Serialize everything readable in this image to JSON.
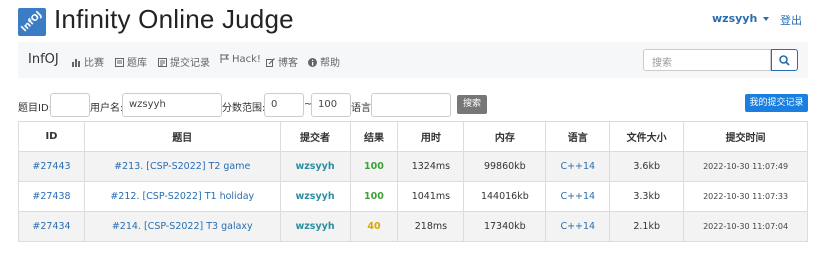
{
  "header": {
    "logo_text": "InfOJ",
    "title": "Infinity Online Judge",
    "user": "wzsyyh",
    "logout": "登出"
  },
  "navbar": {
    "brand": "InfOJ",
    "items": [
      {
        "label": "比赛",
        "icon": "bar-chart-icon"
      },
      {
        "label": "题库",
        "icon": "book-icon"
      },
      {
        "label": "提交记录",
        "icon": "list-icon"
      },
      {
        "label": "Hack!",
        "icon": "flag-icon"
      },
      {
        "label": "博客",
        "icon": "edit-icon"
      },
      {
        "label": "帮助",
        "icon": "info-icon"
      }
    ],
    "search_placeholder": "搜索"
  },
  "filters": {
    "problem_id_label": "题目ID:",
    "problem_id_value": "",
    "username_label": "用户名:",
    "username_value": "wzsyyh",
    "score_label": "分数范围:",
    "score_min": "0",
    "score_sep": "~",
    "score_max": "100",
    "lang_label": "语言:",
    "lang_value": "",
    "search_button": "搜索",
    "my_submissions_button": "我的提交记录"
  },
  "table": {
    "headers": [
      "ID",
      "题目",
      "提交者",
      "结果",
      "用时",
      "内存",
      "语言",
      "文件大小",
      "提交时间"
    ],
    "rows": [
      {
        "id": "#27443",
        "problem": "#213. [CSP-S2022] T2 game",
        "user": "wzsyyh",
        "result": "100",
        "time": "1324ms",
        "memory": "99860kb",
        "lang": "C++14",
        "size": "3.6kb",
        "submitted": "2022-10-30 11:07:49"
      },
      {
        "id": "#27438",
        "problem": "#212. [CSP-S2022] T1 holiday",
        "user": "wzsyyh",
        "result": "100",
        "time": "1041ms",
        "memory": "144016kb",
        "lang": "C++14",
        "size": "3.3kb",
        "submitted": "2022-10-30 11:07:33"
      },
      {
        "id": "#27434",
        "problem": "#214. [CSP-S2022] T3 galaxy",
        "user": "wzsyyh",
        "result": "40",
        "time": "218ms",
        "memory": "17340kb",
        "lang": "C++14",
        "size": "2.1kb",
        "submitted": "2022-10-30 11:07:04"
      }
    ]
  },
  "colors": {
    "accent": "#2a6db0",
    "button_primary": "#1a7fe0",
    "result_full": "#3aa33a",
    "result_partial": "#d6a800"
  }
}
